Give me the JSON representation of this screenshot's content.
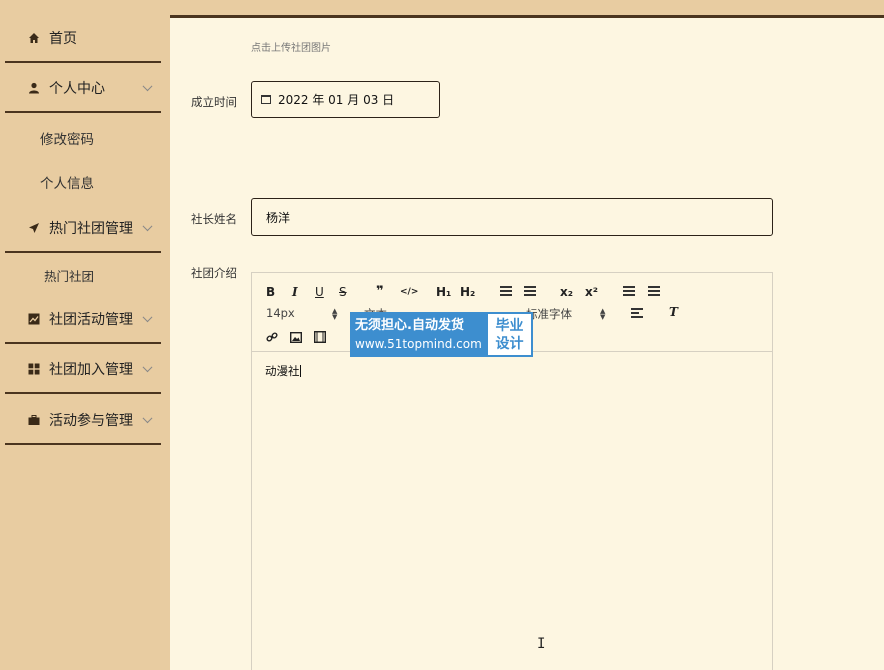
{
  "sidebar": {
    "home": "首页",
    "personal": "个人中心",
    "change_password": "修改密码",
    "personal_info": "个人信息",
    "hot_club_mgmt": "热门社团管理",
    "hot_club": "热门社团",
    "activity_mgmt": "社团活动管理",
    "join_mgmt": "社团加入管理",
    "participation_mgmt": "活动参与管理"
  },
  "form": {
    "upload_hint": "点击上传社团图片",
    "founded_label": "成立时间",
    "founded_value": "2022 年 01 月 03 日",
    "president_label": "社长姓名",
    "president_value": "杨洋",
    "intro_label": "社团介绍"
  },
  "editor": {
    "bold": "B",
    "italic": "I",
    "underline": "U",
    "strike": "S",
    "blockquote": "❞",
    "code": "</>",
    "h1": "H₁",
    "h2": "H₂",
    "sub": "x₂",
    "sup": "x²",
    "font_size": "14px",
    "text_select": "文本",
    "font_family": "标准字体",
    "content": "动漫社"
  },
  "watermark": {
    "line1": "无须担心.自动发货",
    "line2": "www.51topmind.com",
    "right1": "毕业",
    "right2": "设计"
  }
}
